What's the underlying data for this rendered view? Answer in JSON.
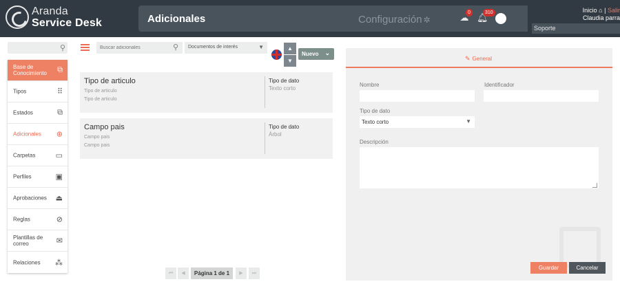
{
  "header": {
    "brand_top": "Aranda",
    "brand_bottom": "Service Desk",
    "page_title": "Adicionales",
    "config_label": "Configuración",
    "cloud_badge": "0",
    "bell_badge": "310",
    "inicio_label": "Inicio",
    "separator": "|",
    "salir_label": "Salir",
    "user_name": "Claudia parra",
    "project": "Soporte"
  },
  "sidebar": {
    "items": [
      {
        "label": "Base de Conocimiento",
        "icon": "copy-icon"
      },
      {
        "label": "Tipos",
        "icon": "grid-icon"
      },
      {
        "label": "Estados",
        "icon": "states-icon"
      },
      {
        "label": "Adicionales",
        "icon": "plus-circle-icon"
      },
      {
        "label": "Carpetas",
        "icon": "folder-icon"
      },
      {
        "label": "Perfiles",
        "icon": "badge-icon"
      },
      {
        "label": "Aprobaciones",
        "icon": "stamp-icon"
      },
      {
        "label": "Reglas",
        "icon": "compass-icon"
      },
      {
        "label": "Plantillas de correo",
        "icon": "mail-icon"
      },
      {
        "label": "Relaciones",
        "icon": "relations-icon"
      }
    ]
  },
  "toolbar": {
    "search_placeholder": "Buscar adicionales",
    "filter_value": "Documentos de interés",
    "new_label": "Nuevo"
  },
  "list": {
    "type_label": "Tipo de dato",
    "items": [
      {
        "name": "Tipo de articulo",
        "sub1": "Tipo de articulo",
        "sub2": "Tipo de articulo",
        "type": "Texto corto"
      },
      {
        "name": "Campo pais",
        "sub1": "Campo pais",
        "sub2": "Campo pais",
        "type": "Árbol"
      }
    ]
  },
  "pagination": {
    "label": "Página 1 de 1"
  },
  "detail": {
    "tab_label": "General",
    "nombre_label": "Nombre",
    "nombre_value": "",
    "identificador_label": "Identificador",
    "identificador_value": "",
    "tipo_label": "Tipo de dato",
    "tipo_value": "Texto corto",
    "descripcion_label": "Descripción",
    "save_label": "Guardar",
    "cancel_label": "Cancelar"
  },
  "colors": {
    "header_bg": "#313a42",
    "accent": "#ee8064",
    "active_nav": "#ee8064",
    "new_button": "#7d8f8a",
    "cancel_button": "#4f565c"
  }
}
